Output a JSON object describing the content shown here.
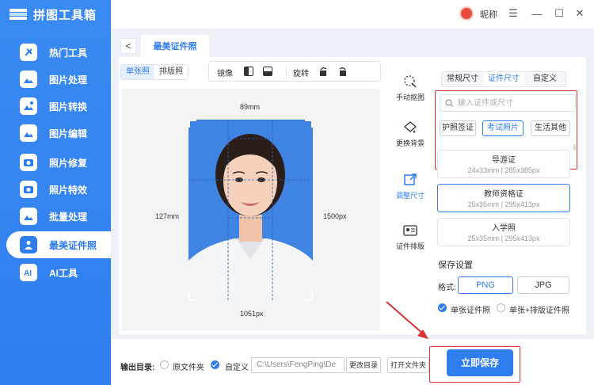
{
  "app": {
    "title": "拼图工具箱"
  },
  "sidebar": {
    "items": [
      {
        "label": "热门工具",
        "icon": "hot-tools-icon"
      },
      {
        "label": "图片处理",
        "icon": "image-process-icon"
      },
      {
        "label": "图片转换",
        "icon": "image-convert-icon"
      },
      {
        "label": "图片编辑",
        "icon": "image-edit-icon"
      },
      {
        "label": "照片修复",
        "icon": "photo-repair-icon"
      },
      {
        "label": "照片特效",
        "icon": "photo-effect-icon"
      },
      {
        "label": "批量处理",
        "icon": "batch-process-icon"
      },
      {
        "label": "最美证件照",
        "icon": "id-photo-icon",
        "active": true
      },
      {
        "label": "AI工具",
        "icon": "ai-tools-icon"
      }
    ]
  },
  "topbar": {
    "nickname": "昵称",
    "menu": "☰",
    "minimize": "—",
    "maximize": "☐",
    "close": "✕"
  },
  "page": {
    "back": "<",
    "title": "最美证件照"
  },
  "toolbar": {
    "single": "单张照",
    "layout": "排版照",
    "mirror": "镜像",
    "rotate": "旋转"
  },
  "preview": {
    "width_mm": "89mm",
    "height_mm": "127mm",
    "width_px": "1051px",
    "height_px": "1500px"
  },
  "side_tools": [
    {
      "label": "手动抠图",
      "icon": "manual-cutout-icon"
    },
    {
      "label": "更换背景",
      "icon": "change-background-icon"
    },
    {
      "label": "调整尺寸",
      "icon": "resize-icon",
      "active": true
    },
    {
      "label": "证件排版",
      "icon": "id-layout-icon"
    }
  ],
  "size_tabs": [
    "常规尺寸",
    "证件尺寸",
    "自定义"
  ],
  "search": {
    "placeholder": "输入证件或尺寸"
  },
  "categories": [
    "护照签证",
    "考试照片",
    "生活其他"
  ],
  "sizes": [
    {
      "name": "导游证",
      "detail": "24x33mm | 285x385px"
    },
    {
      "name": "教师资格证",
      "detail": "25x35mm | 295x413px"
    },
    {
      "name": "入学照",
      "detail": "25x35mm | 295x413px"
    }
  ],
  "save_settings": {
    "title": "保存设置",
    "format_label": "格式:",
    "formats": [
      "PNG",
      "JPG"
    ],
    "option_single": "单张证件照",
    "option_both": "单张+排版证件照"
  },
  "bottom": {
    "output_label": "输出目录:",
    "original_folder": "原文件夹",
    "custom": "自定义",
    "path": "C:\\Users\\FengPing\\De",
    "change_dir": "更改目录",
    "open_folder": "打开文件夹",
    "save": "立即保存"
  },
  "colors": {
    "accent": "#2e7ef0",
    "highlight_box": "#d93030",
    "photo_bg": "#3f83e3"
  }
}
